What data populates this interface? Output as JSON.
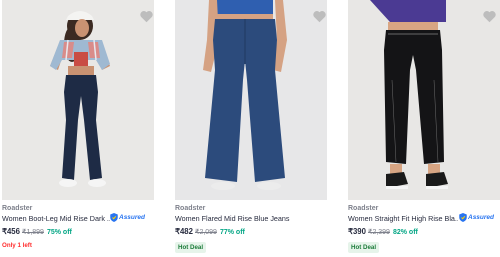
{
  "products": [
    {
      "brand": "Roadster",
      "title": "Women Boot-Leg Mid Rise Dark ...",
      "assured": "Assured",
      "price": "₹456",
      "mrp": "₹1,899",
      "discount": "75% off",
      "tag": "Only 1 left",
      "tag_type": "stock"
    },
    {
      "brand": "Roadster",
      "title": "Women Flared Mid Rise Blue Jeans",
      "price": "₹482",
      "mrp": "₹2,099",
      "discount": "77% off",
      "tag": "Hot Deal",
      "tag_type": "deal"
    },
    {
      "brand": "Roadster",
      "title": "Women Straight Fit High Rise Bla...",
      "assured": "Assured",
      "price": "₹390",
      "mrp": "₹2,399",
      "discount": "82% off",
      "tag": "Hot Deal",
      "tag_type": "deal"
    }
  ],
  "icons": {
    "wishlist": "heart-icon",
    "assured": "assured-badge-icon"
  },
  "colors": {
    "discount": "#03a685",
    "stock": "#ff2c2c",
    "deal_bg": "#e6f4ea",
    "assured": "#2874f0"
  }
}
